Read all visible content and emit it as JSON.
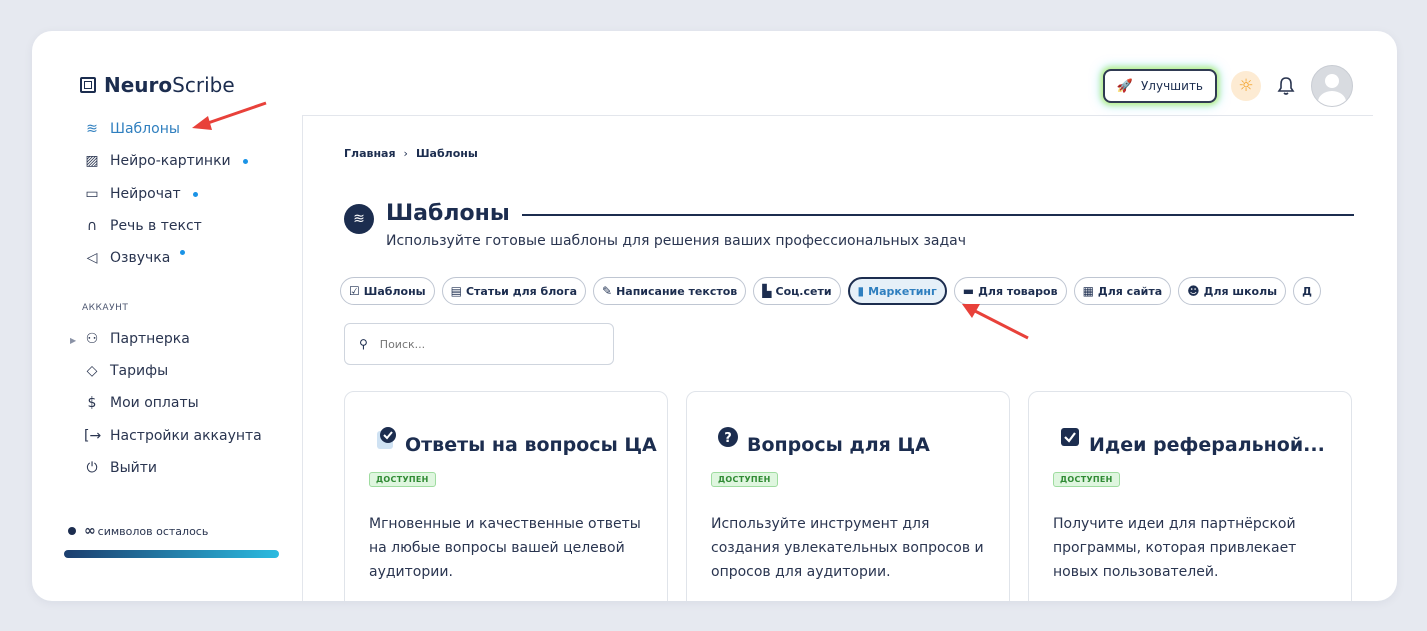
{
  "app": {
    "name_bold": "Neuro",
    "name_light": "Scribe"
  },
  "header": {
    "upgrade_label": "Улучшить"
  },
  "sidebar": {
    "items": [
      {
        "label": "Шаблоны",
        "icon": "layers-icon"
      },
      {
        "label": "Нейро-картинки",
        "icon": "image-icon"
      },
      {
        "label": "Нейрочат",
        "icon": "chat-icon"
      },
      {
        "label": "Речь в текст",
        "icon": "headphones-icon"
      },
      {
        "label": "Озвучка",
        "icon": "speaker-icon"
      }
    ],
    "section_label": "АККАУНТ",
    "account_items": [
      {
        "label": "Партнерка",
        "icon": "users-icon"
      },
      {
        "label": "Тарифы",
        "icon": "tag-icon"
      },
      {
        "label": "Мои оплаты",
        "icon": "dollar-icon"
      },
      {
        "label": "Настройки аккаунта",
        "icon": "logout-arrow-icon"
      },
      {
        "label": "Выйти",
        "icon": "power-icon"
      }
    ],
    "symbols_inf": "∞",
    "symbols_text": "символов осталось"
  },
  "breadcrumb": {
    "home": "Главная",
    "sep": "›",
    "current": "Шаблоны"
  },
  "page": {
    "title": "Шаблоны",
    "subtitle": "Используйте готовые шаблоны для решения ваших профессиональных задач"
  },
  "chips": [
    {
      "icon": "☑",
      "label": "Шаблоны"
    },
    {
      "icon": "▤",
      "label": "Статьи для блога"
    },
    {
      "icon": "✎",
      "label": "Написание текстов"
    },
    {
      "icon": "▙",
      "label": "Соц.сети"
    },
    {
      "icon": "▮",
      "label": "Маркетинг"
    },
    {
      "icon": "▬",
      "label": "Для товаров"
    },
    {
      "icon": "▦",
      "label": "Для сайта"
    },
    {
      "icon": "☻",
      "label": "Для школы"
    },
    {
      "icon": "",
      "label": "Д"
    }
  ],
  "search": {
    "placeholder": "Поиск..."
  },
  "cards": [
    {
      "icon": "✔",
      "title": "Ответы на вопросы ЦА",
      "badge": "ДОСТУПЕН",
      "desc": "Мгновенные и качественные ответы на любые вопросы вашей целевой аудитории."
    },
    {
      "icon": "?",
      "title": "Вопросы для ЦА",
      "badge": "ДОСТУПЕН",
      "desc": "Используйте инструмент для создания увлекательных вопросов и опросов для аудитории."
    },
    {
      "icon": "☑",
      "title": "Идеи реферальной...",
      "badge": "ДОСТУПЕН",
      "desc": "Получите идеи для партнёрской программы, которая привлекает новых пользователей."
    }
  ],
  "colors": {
    "accent": "#2f7fbf",
    "primary": "#1c2d4f",
    "annotation_arrow": "#e8413a"
  }
}
